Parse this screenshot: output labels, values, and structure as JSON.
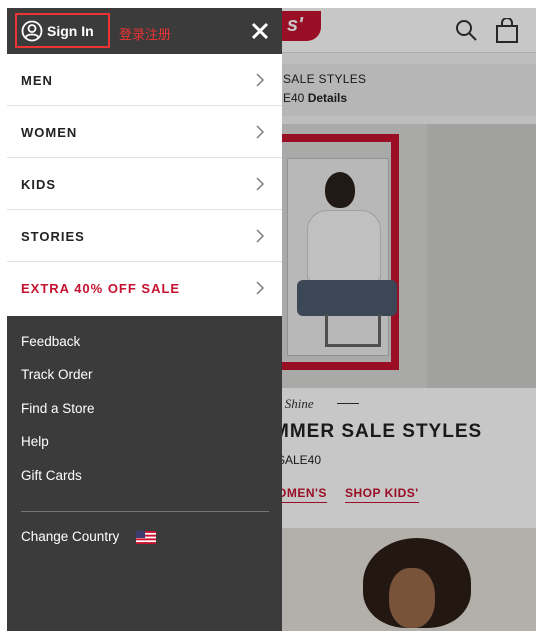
{
  "drawer": {
    "signin_label": "Sign In",
    "annotation": "登录注册",
    "menu": [
      {
        "label": "MEN",
        "sale": false
      },
      {
        "label": "WOMEN",
        "sale": false
      },
      {
        "label": "KIDS",
        "sale": false
      },
      {
        "label": "STORIES",
        "sale": false
      },
      {
        "label": "EXTRA 40% OFF SALE",
        "sale": true
      }
    ],
    "links": [
      "Feedback",
      "Track Order",
      "Find a Store",
      "Help",
      "Gift Cards"
    ],
    "country_label": "Change Country"
  },
  "background": {
    "logo_fragment": "s'",
    "promo_line1": "SALE STYLES",
    "promo_code_fragment": "E40",
    "promo_details": "Details",
    "tagline": "n Shine",
    "title_fragment": "MMER SALE STYLES",
    "code_fragment": "SALE40",
    "link_a": "OMEN'S",
    "link_b": "SHOP KIDS'"
  },
  "colors": {
    "drawer_bg": "#3b3b3b",
    "accent_red": "#c41230",
    "annotation_red": "#e33333"
  },
  "icons": [
    "user-circle-icon",
    "close-icon",
    "chevron-right-icon",
    "search-icon",
    "shopping-bag-icon",
    "us-flag-icon"
  ]
}
